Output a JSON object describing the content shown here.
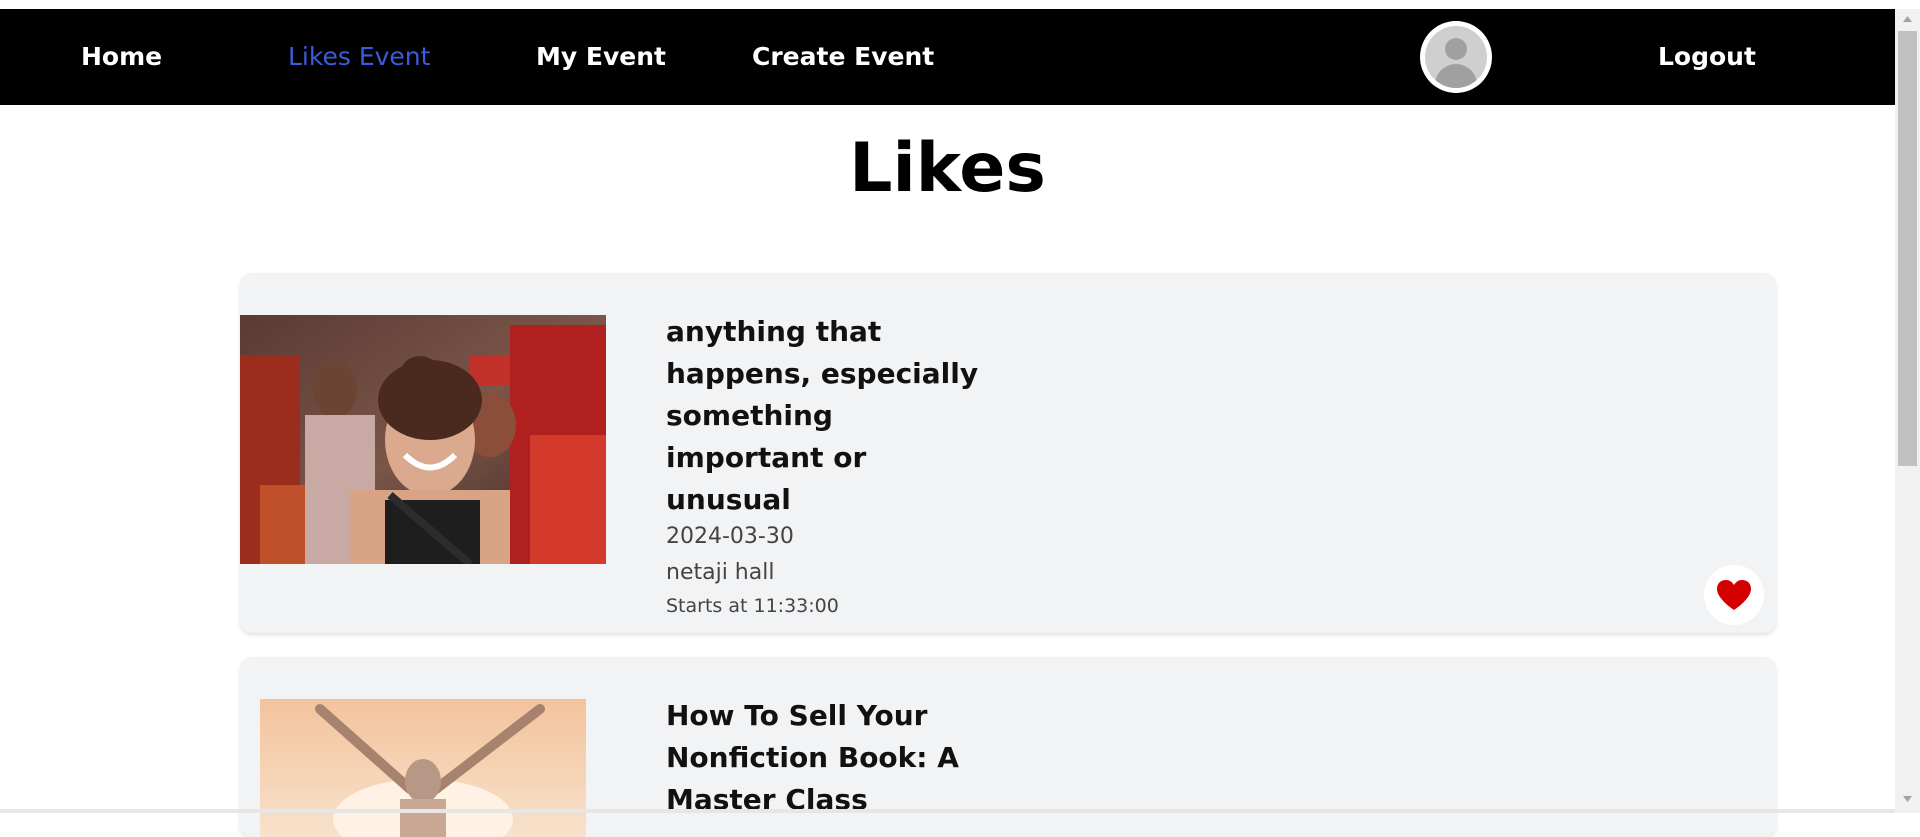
{
  "nav": {
    "items": [
      {
        "label": "Home",
        "active": false
      },
      {
        "label": "Likes Event",
        "active": true
      },
      {
        "label": "My Event",
        "active": false
      },
      {
        "label": "Create Event",
        "active": false
      }
    ],
    "logout_label": "Logout",
    "avatar_icon": "user-avatar-icon",
    "active_color": "#3b5bdb",
    "background_color": "#000000"
  },
  "page": {
    "title": "Likes"
  },
  "events": [
    {
      "title": "anything that happens, especially something important or unusual",
      "date": "2024-03-30",
      "venue": "netaji hall",
      "time": "Starts at 11:33:00",
      "liked": true,
      "like_icon": "heart-icon",
      "like_color": "#d40000"
    },
    {
      "title": "How To Sell Your Nonfiction Book: A Master Class",
      "liked": true,
      "like_icon": "heart-icon"
    }
  ]
}
